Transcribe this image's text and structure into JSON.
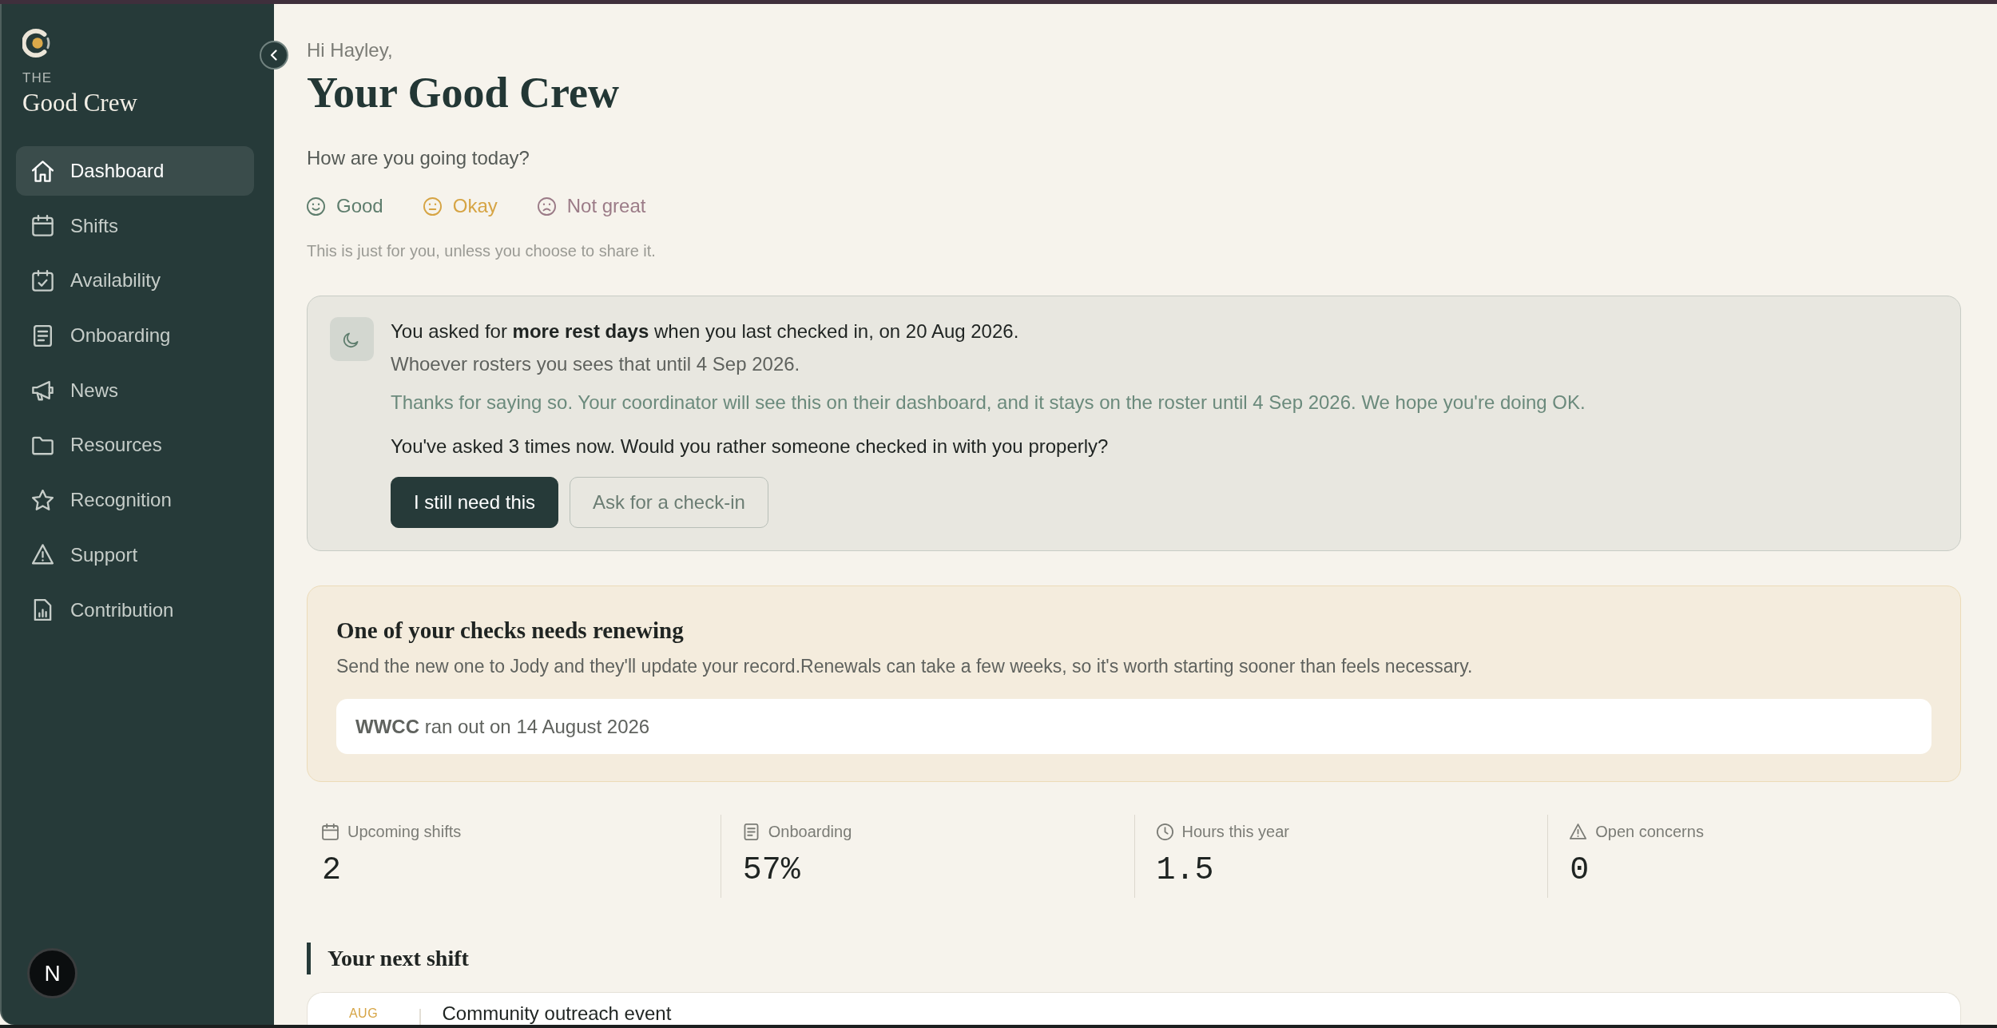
{
  "sidebar": {
    "brand": {
      "prefix": "THE",
      "name": "Good Crew"
    },
    "items": [
      {
        "kind": "home",
        "label": "Dashboard",
        "selected": true
      },
      {
        "kind": "calendar",
        "label": "Shifts",
        "selected": false
      },
      {
        "kind": "calendar-check",
        "label": "Availability",
        "selected": false
      },
      {
        "kind": "document",
        "label": "Onboarding",
        "selected": false
      },
      {
        "kind": "megaphone",
        "label": "News",
        "selected": false
      },
      {
        "kind": "folder",
        "label": "Resources",
        "selected": false
      },
      {
        "kind": "star",
        "label": "Recognition",
        "selected": false
      },
      {
        "kind": "warning",
        "label": "Support",
        "selected": false
      },
      {
        "kind": "report",
        "label": "Contribution",
        "selected": false
      }
    ],
    "dev_badge": {
      "label": "N"
    }
  },
  "header": {
    "greeting": "Hi Hayley,",
    "title": "Your Good Crew"
  },
  "mood": {
    "question": "How are you going today?",
    "options": [
      {
        "kind": "happy",
        "label": "Good",
        "color": "#5e7d6d"
      },
      {
        "kind": "neutral",
        "label": "Okay",
        "color": "#d6a444"
      },
      {
        "kind": "sad",
        "label": "Not great",
        "color": "#9b7b87"
      }
    ],
    "note": "This is just for you, unless you choose to share it."
  },
  "rest_request": {
    "summary": "You asked for **more rest days** when you last checked in, on 20 Aug 2026.",
    "visibility": "Whoever rosters you sees that until 4 Sep 2026.",
    "acknowledgement": "Thanks for saying so. Your coordinator will see this on their dashboard, and it stays on the roster until 4 Sep 2026. We hope you're doing OK.",
    "prompt": "You've asked 3 times now. Would you rather someone checked in with you properly?",
    "buttons": [
      {
        "kind": "primary",
        "label": "I still need this"
      },
      {
        "kind": "secondary",
        "label": "Ask for a check-in"
      }
    ]
  },
  "renewal": {
    "title": "One of your checks needs renewing",
    "description": "Send the new one to Jody and they'll update your record.Renewals can take a few weeks, so it's worth starting sooner than feels necessary.",
    "checks": [
      {
        "text": "**WWCC** ran out on 14 August 2026"
      }
    ]
  },
  "stats": [
    {
      "kind": "calendar",
      "label": "Upcoming shifts",
      "value": "2"
    },
    {
      "kind": "document",
      "label": "Onboarding",
      "value": "57%"
    },
    {
      "kind": "clock",
      "label": "Hours this year",
      "value": "1.5"
    },
    {
      "kind": "warning",
      "label": "Open concerns",
      "value": "0"
    }
  ],
  "next_shift": {
    "heading": "Your next shift",
    "month": "AUG",
    "title": "Community outreach event"
  }
}
